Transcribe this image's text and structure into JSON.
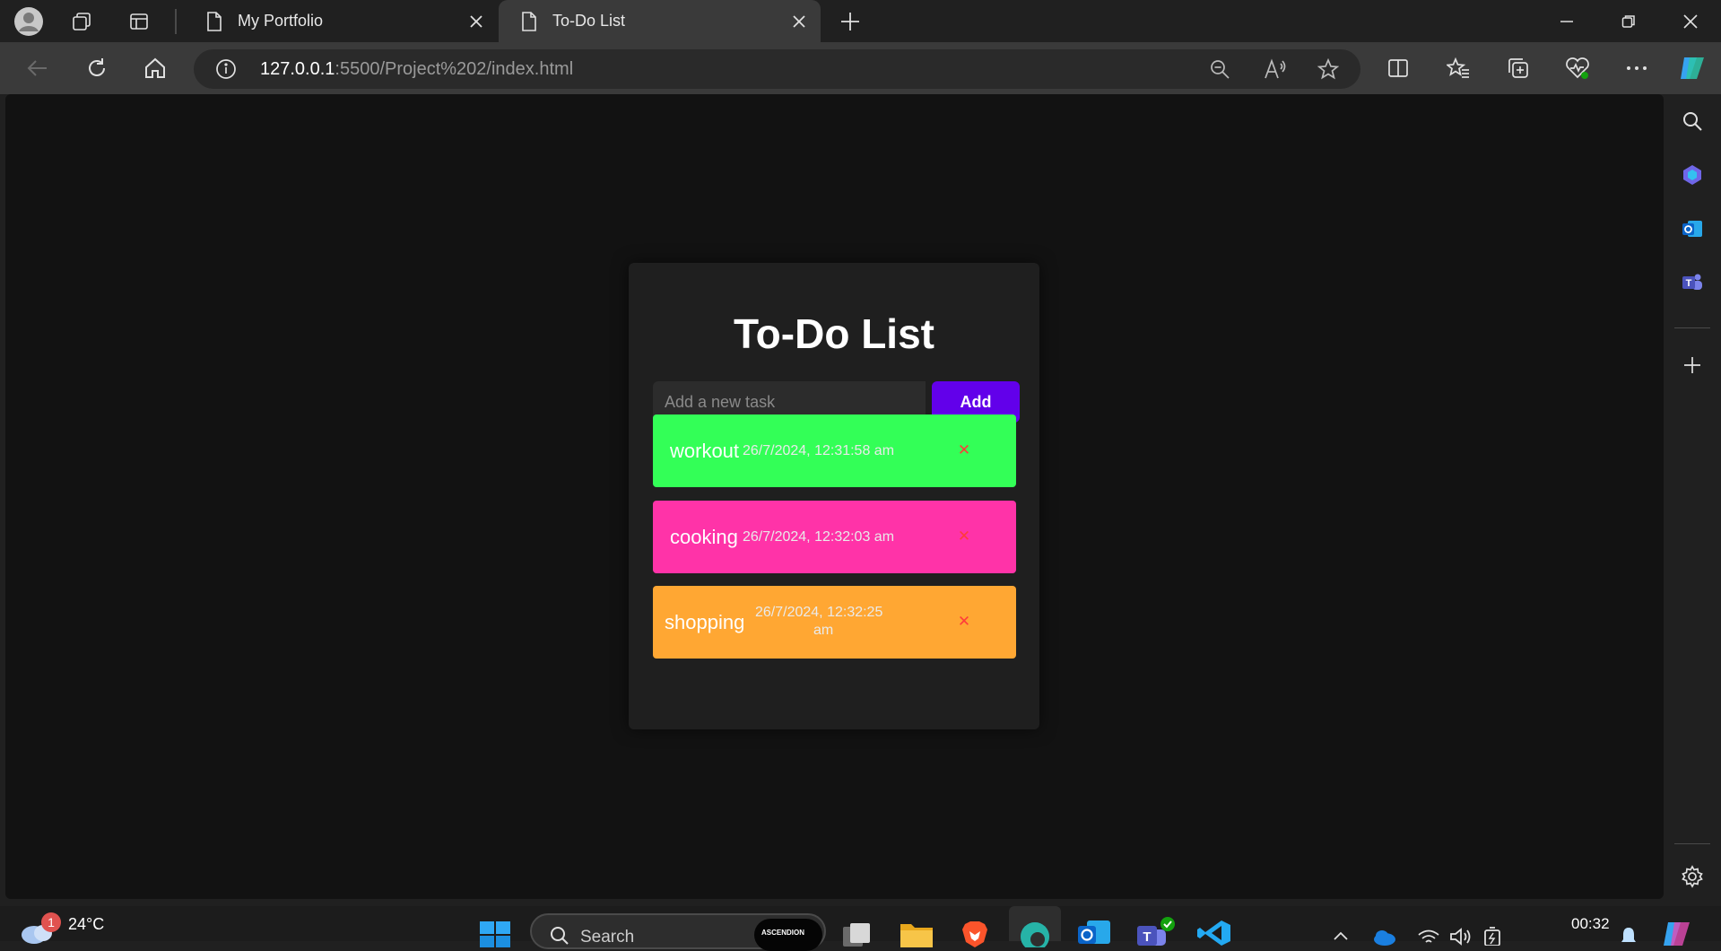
{
  "browser": {
    "tabs": [
      {
        "title": "My Portfolio",
        "active": false
      },
      {
        "title": "To-Do List",
        "active": true
      }
    ],
    "url_host": "127.0.0.1",
    "url_rest": ":5500/Project%202/index.html"
  },
  "app": {
    "title": "To-Do List",
    "input_placeholder": "Add a new task",
    "add_label": "Add",
    "delete_glyph": "✕",
    "tasks": [
      {
        "name": "workout",
        "time": "26/7/2024, 12:31:58 am",
        "color": "#33ff57"
      },
      {
        "name": "cooking",
        "time": "26/7/2024, 12:32:03 am",
        "color": "#ff33a8"
      },
      {
        "name": "shopping",
        "time_line1": "26/7/2024, 12:32:25",
        "time_line2": "am",
        "color": "#ffa733"
      }
    ],
    "colors": {
      "accent": "#6200ea",
      "background": "#121212",
      "card": "#1f1f1f",
      "delete": "#ff3b3b"
    }
  },
  "taskbar": {
    "weather_temp": "24°C",
    "weather_badge": "1",
    "search_label": "Search",
    "search_badge_text": "ASCENDION",
    "clock": "00:32"
  }
}
